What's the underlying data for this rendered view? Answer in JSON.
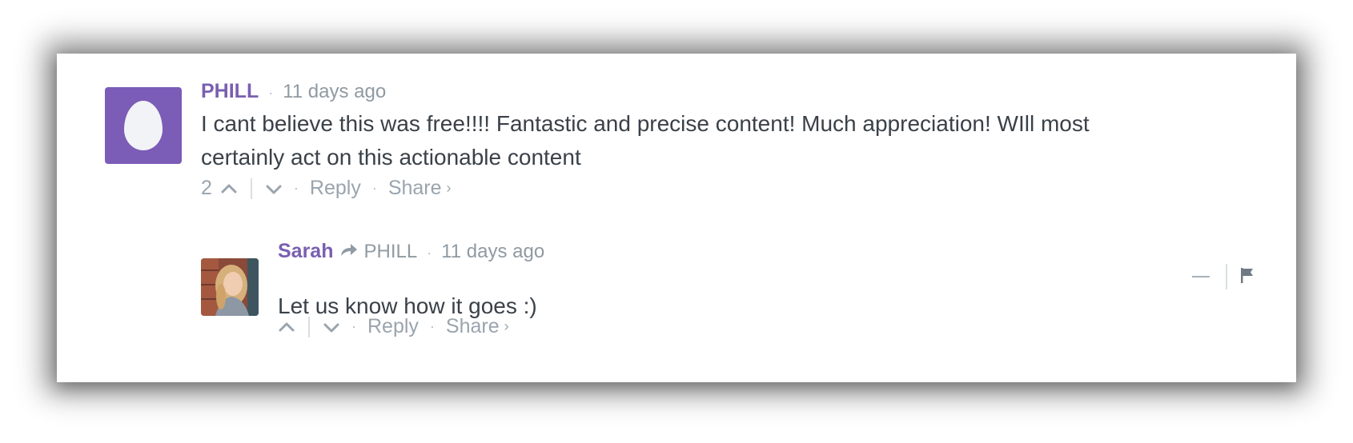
{
  "comment": {
    "author": "PHILL",
    "separator": "·",
    "time": "11 days ago",
    "text_line1": "I cant believe this was free!!!! Fantastic and precise content! Much appreciation! WIll most",
    "text_line2": "certainly act on this actionable content",
    "upvotes": "2",
    "reply_label": "Reply",
    "share_label": "Share",
    "share_chevron": "›",
    "avatar_color": "#7b5cb6"
  },
  "reply": {
    "author": "Sarah",
    "reply_to": "PHILL",
    "separator": "·",
    "time": "11 days ago",
    "text": "Let us know how it goes :)",
    "reply_label": "Reply",
    "share_label": "Share",
    "share_chevron": "›"
  },
  "icons": {
    "upvote": "chevron-up-icon",
    "downvote": "chevron-down-icon",
    "reply_to": "reply-arrow-icon",
    "collapse": "minus-icon",
    "flag": "flag-icon"
  },
  "colors": {
    "author": "#7a5fb0",
    "meta": "#8f9aa3",
    "text": "#3a4148"
  }
}
